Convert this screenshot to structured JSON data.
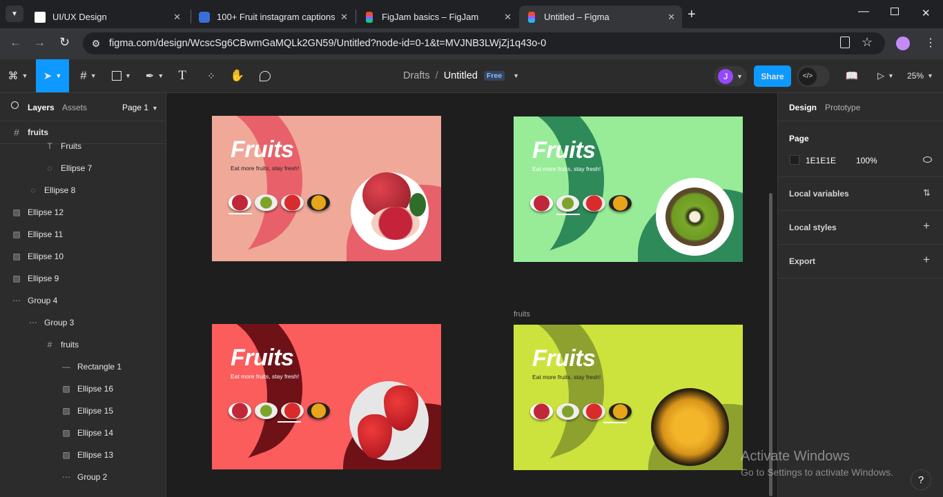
{
  "browser": {
    "tabs": [
      {
        "title": "UI/UX Design",
        "favicon_color": "#ffffff"
      },
      {
        "title": "100+ Fruit instagram captions",
        "favicon_color": "#3b6fd8"
      },
      {
        "title": "FigJam basics – FigJam",
        "favicon_color": "#f24e1e"
      },
      {
        "title": "Untitled – Figma",
        "favicon_color": "#a259ff"
      }
    ],
    "url": "figma.com/design/WcscSg6CBwmGaMQLk2GN59/Untitled?node-id=0-1&t=MVJNB3LWjZj1q43o-0"
  },
  "toolbar": {
    "breadcrumb_parent": "Drafts",
    "breadcrumb_sep": "/",
    "file_name": "Untitled",
    "plan_badge": "Free",
    "avatar_initial": "J",
    "share_label": "Share",
    "zoom": "25%"
  },
  "left_panel": {
    "tabs": [
      "Layers",
      "Assets"
    ],
    "page_label": "Page 1",
    "root_frame": "fruits",
    "layers": [
      {
        "name": "Fruits",
        "icon": "text-icon"
      },
      {
        "name": "Ellipse 7",
        "icon": "ellipse-icon"
      },
      {
        "name": "Ellipse 8",
        "icon": "ellipse-icon"
      },
      {
        "name": "Ellipse 12",
        "icon": "image-icon"
      },
      {
        "name": "Ellipse 11",
        "icon": "image-icon"
      },
      {
        "name": "Ellipse 10",
        "icon": "image-icon"
      },
      {
        "name": "Ellipse 9",
        "icon": "image-icon"
      },
      {
        "name": "Group 4",
        "icon": "group-icon"
      },
      {
        "name": "Group 3",
        "icon": "group-icon"
      },
      {
        "name": "fruits",
        "icon": "frame-icon"
      },
      {
        "name": "Rectangle 1",
        "icon": "line-icon"
      },
      {
        "name": "Ellipse 16",
        "icon": "image-icon"
      },
      {
        "name": "Ellipse 15",
        "icon": "image-icon"
      },
      {
        "name": "Ellipse 14",
        "icon": "image-icon"
      },
      {
        "name": "Ellipse 13",
        "icon": "image-icon"
      },
      {
        "name": "Group 2",
        "icon": "group-icon"
      }
    ]
  },
  "right_panel": {
    "tabs": [
      "Design",
      "Prototype"
    ],
    "page_heading": "Page",
    "page_color": "1E1E1E",
    "page_opacity": "100%",
    "sections": [
      "Local variables",
      "Local styles",
      "Export"
    ]
  },
  "canvas": {
    "frame_label": "fruits",
    "frames": [
      {
        "title": "Fruits",
        "tagline": "Eat more fruits, stay fresh!",
        "bg": "#f0a898",
        "accent": "#e8616a"
      },
      {
        "title": "Fruits",
        "tagline": "Eat more fruits, stay fresh!",
        "bg": "#98ec98",
        "accent": "#2f8a5a"
      },
      {
        "title": "Fruits",
        "tagline": "Eat more fruits, stay fresh!",
        "bg": "#fb5c5c",
        "accent": "#6e1218"
      },
      {
        "title": "Fruits",
        "tagline": "Eat more fruits, stay fresh!",
        "bg": "#cce33e",
        "accent": "#8ea12f"
      }
    ]
  },
  "overlay": {
    "activate_title": "Activate Windows",
    "activate_sub": "Go to Settings to activate Windows.",
    "help": "?"
  }
}
